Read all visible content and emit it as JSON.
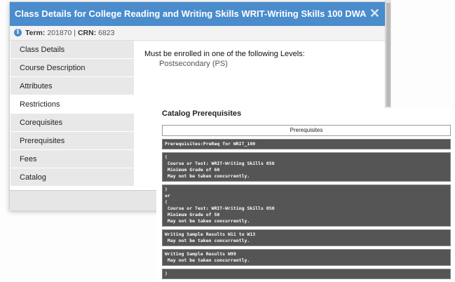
{
  "dialog": {
    "title": "Class Details for College Reading and Writing Skills WRIT-Writing Skills 100 DWA",
    "close_symbol": "✕",
    "term_label": "Term:",
    "term_value": "201870",
    "separator": "|",
    "crn_label": "CRN:",
    "crn_value": "6823"
  },
  "sidebar": {
    "items": [
      {
        "label": "Class Details"
      },
      {
        "label": "Course Description"
      },
      {
        "label": "Attributes"
      },
      {
        "label": "Restrictions",
        "active": true
      },
      {
        "label": "Corequisites"
      },
      {
        "label": "Prerequisites"
      },
      {
        "label": "Fees"
      },
      {
        "label": "Catalog"
      }
    ]
  },
  "restrictions": {
    "heading": "Must be enrolled in one of the following Levels:",
    "level": "Postsecondary (PS)"
  },
  "catalog": {
    "title": "Catalog Prerequisites",
    "table_header": "Prerequisites",
    "blocks": [
      [
        "Prerequisites:PreReq for WRIT_100"
      ],
      [
        "(",
        " Course or Test: WRIT-Writing Skills 050",
        " Minimum Grade of 60",
        " May not be taken concurrently."
      ],
      [
        ")",
        "or",
        "(",
        " Course or Test: WRIT-Writing Skills 050",
        " Minimum Grade of 50",
        " May not be taken concurrently."
      ],
      [
        "Writing Sample Results W11 to W13",
        " May not be taken concurrently."
      ],
      [
        "Writing Sample Results W99",
        " May not be taken concurrently."
      ],
      [
        ")"
      ]
    ]
  }
}
